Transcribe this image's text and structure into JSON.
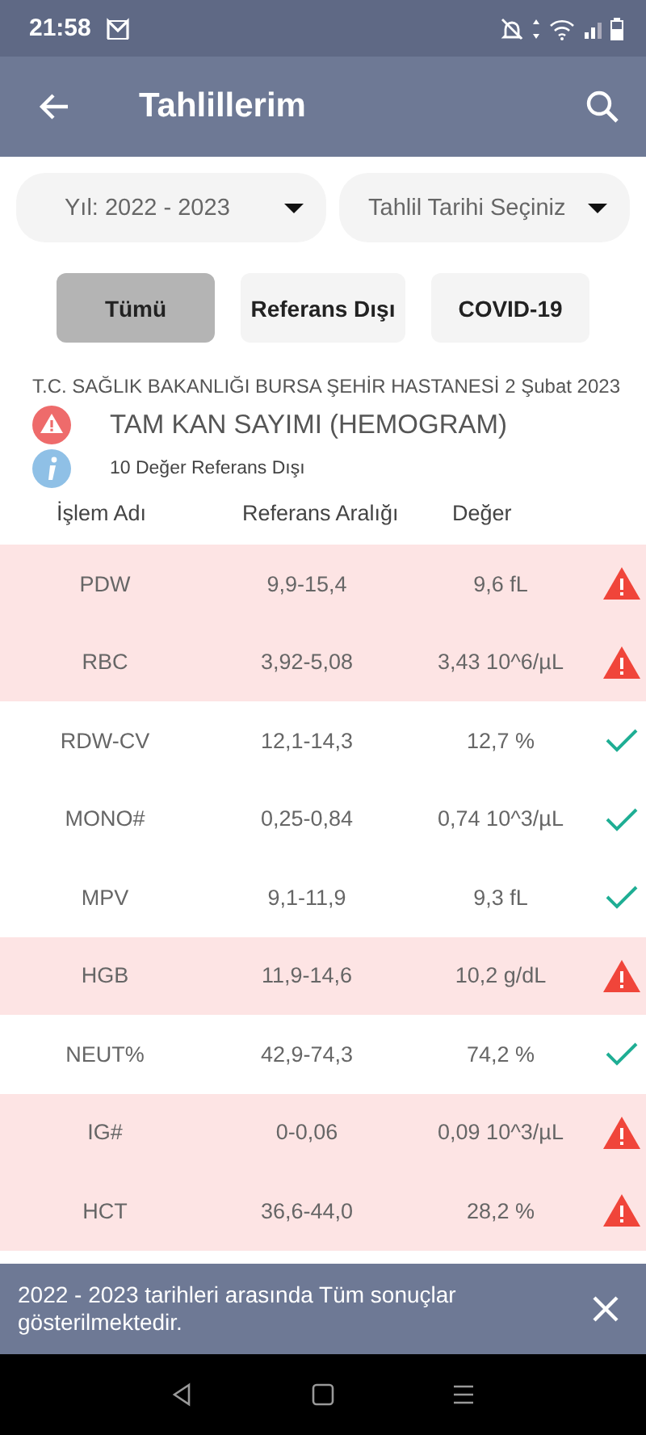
{
  "status_bar": {
    "time": "21:58"
  },
  "app_bar": {
    "title": "Tahlillerim"
  },
  "dropdowns": [
    {
      "value": "Yıl: 2022 - 2023"
    },
    {
      "placeholder": "Tahlil Tarihi Seçiniz"
    }
  ],
  "filters": [
    {
      "label": "Tümü",
      "selected": true
    },
    {
      "label": "Referans Dışı",
      "selected": false
    },
    {
      "label": "COVID-19",
      "selected": false
    }
  ],
  "report": {
    "hospital": "T.C. SAĞLIK BAKANLIĞI BURSA ŞEHİR HASTANESİ",
    "date": "2 Şubat 2023",
    "title": "TAM KAN SAYIMI (HEMOGRAM)",
    "summary": "10 Değer Referans Dışı"
  },
  "table": {
    "columns": [
      "İşlem Adı",
      "Referans Aralığı",
      "Değer"
    ],
    "rows": [
      {
        "name": "PDW",
        "range": "9,9-15,4",
        "value": "9,6 fL",
        "out_of_range": true
      },
      {
        "name": "RBC",
        "range": "3,92-5,08",
        "value": "3,43 10^6/µL",
        "out_of_range": true
      },
      {
        "name": "RDW-CV",
        "range": "12,1-14,3",
        "value": "12,7 %",
        "out_of_range": false
      },
      {
        "name": "MONO#",
        "range": "0,25-0,84",
        "value": "0,74 10^3/µL",
        "out_of_range": false
      },
      {
        "name": "MPV",
        "range": "9,1-11,9",
        "value": "9,3 fL",
        "out_of_range": false
      },
      {
        "name": "HGB",
        "range": "11,9-14,6",
        "value": "10,2 g/dL",
        "out_of_range": true
      },
      {
        "name": "NEUT%",
        "range": "42,9-74,3",
        "value": "74,2 %",
        "out_of_range": false
      },
      {
        "name": "IG#",
        "range": "0-0,06",
        "value": "0,09 10^3/µL",
        "out_of_range": true
      },
      {
        "name": "HCT",
        "range": "36,6-44,0",
        "value": "28,2 %",
        "out_of_range": true
      }
    ]
  },
  "snackbar": {
    "message": "2022 - 2023 tarihleri arasında Tüm sonuçlar gösterilmektedir."
  }
}
